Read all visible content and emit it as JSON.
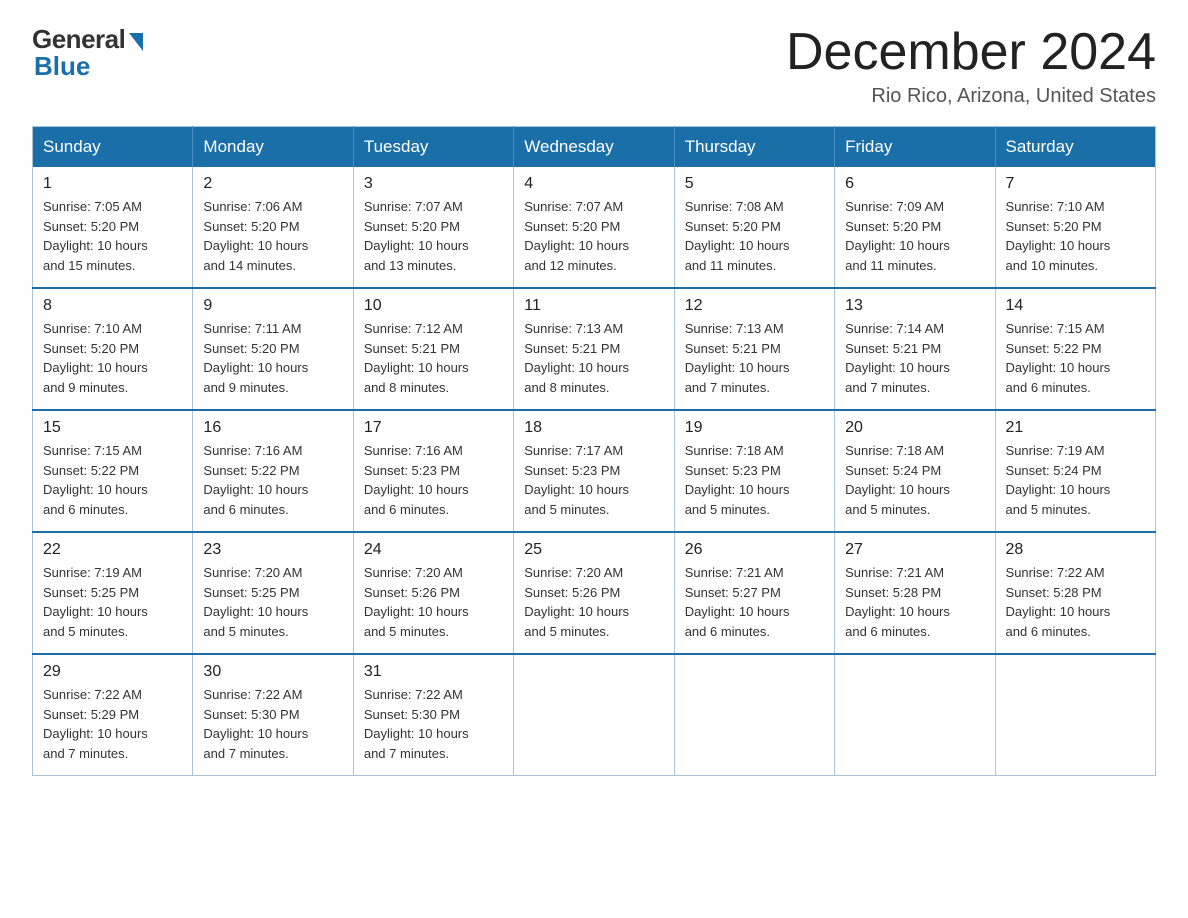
{
  "logo": {
    "general": "General",
    "blue": "Blue"
  },
  "title": {
    "month_year": "December 2024",
    "location": "Rio Rico, Arizona, United States"
  },
  "days_of_week": [
    "Sunday",
    "Monday",
    "Tuesday",
    "Wednesday",
    "Thursday",
    "Friday",
    "Saturday"
  ],
  "weeks": [
    [
      {
        "day": "1",
        "sunrise": "7:05 AM",
        "sunset": "5:20 PM",
        "daylight": "10 hours and 15 minutes."
      },
      {
        "day": "2",
        "sunrise": "7:06 AM",
        "sunset": "5:20 PM",
        "daylight": "10 hours and 14 minutes."
      },
      {
        "day": "3",
        "sunrise": "7:07 AM",
        "sunset": "5:20 PM",
        "daylight": "10 hours and 13 minutes."
      },
      {
        "day": "4",
        "sunrise": "7:07 AM",
        "sunset": "5:20 PM",
        "daylight": "10 hours and 12 minutes."
      },
      {
        "day": "5",
        "sunrise": "7:08 AM",
        "sunset": "5:20 PM",
        "daylight": "10 hours and 11 minutes."
      },
      {
        "day": "6",
        "sunrise": "7:09 AM",
        "sunset": "5:20 PM",
        "daylight": "10 hours and 11 minutes."
      },
      {
        "day": "7",
        "sunrise": "7:10 AM",
        "sunset": "5:20 PM",
        "daylight": "10 hours and 10 minutes."
      }
    ],
    [
      {
        "day": "8",
        "sunrise": "7:10 AM",
        "sunset": "5:20 PM",
        "daylight": "10 hours and 9 minutes."
      },
      {
        "day": "9",
        "sunrise": "7:11 AM",
        "sunset": "5:20 PM",
        "daylight": "10 hours and 9 minutes."
      },
      {
        "day": "10",
        "sunrise": "7:12 AM",
        "sunset": "5:21 PM",
        "daylight": "10 hours and 8 minutes."
      },
      {
        "day": "11",
        "sunrise": "7:13 AM",
        "sunset": "5:21 PM",
        "daylight": "10 hours and 8 minutes."
      },
      {
        "day": "12",
        "sunrise": "7:13 AM",
        "sunset": "5:21 PM",
        "daylight": "10 hours and 7 minutes."
      },
      {
        "day": "13",
        "sunrise": "7:14 AM",
        "sunset": "5:21 PM",
        "daylight": "10 hours and 7 minutes."
      },
      {
        "day": "14",
        "sunrise": "7:15 AM",
        "sunset": "5:22 PM",
        "daylight": "10 hours and 6 minutes."
      }
    ],
    [
      {
        "day": "15",
        "sunrise": "7:15 AM",
        "sunset": "5:22 PM",
        "daylight": "10 hours and 6 minutes."
      },
      {
        "day": "16",
        "sunrise": "7:16 AM",
        "sunset": "5:22 PM",
        "daylight": "10 hours and 6 minutes."
      },
      {
        "day": "17",
        "sunrise": "7:16 AM",
        "sunset": "5:23 PM",
        "daylight": "10 hours and 6 minutes."
      },
      {
        "day": "18",
        "sunrise": "7:17 AM",
        "sunset": "5:23 PM",
        "daylight": "10 hours and 5 minutes."
      },
      {
        "day": "19",
        "sunrise": "7:18 AM",
        "sunset": "5:23 PM",
        "daylight": "10 hours and 5 minutes."
      },
      {
        "day": "20",
        "sunrise": "7:18 AM",
        "sunset": "5:24 PM",
        "daylight": "10 hours and 5 minutes."
      },
      {
        "day": "21",
        "sunrise": "7:19 AM",
        "sunset": "5:24 PM",
        "daylight": "10 hours and 5 minutes."
      }
    ],
    [
      {
        "day": "22",
        "sunrise": "7:19 AM",
        "sunset": "5:25 PM",
        "daylight": "10 hours and 5 minutes."
      },
      {
        "day": "23",
        "sunrise": "7:20 AM",
        "sunset": "5:25 PM",
        "daylight": "10 hours and 5 minutes."
      },
      {
        "day": "24",
        "sunrise": "7:20 AM",
        "sunset": "5:26 PM",
        "daylight": "10 hours and 5 minutes."
      },
      {
        "day": "25",
        "sunrise": "7:20 AM",
        "sunset": "5:26 PM",
        "daylight": "10 hours and 5 minutes."
      },
      {
        "day": "26",
        "sunrise": "7:21 AM",
        "sunset": "5:27 PM",
        "daylight": "10 hours and 6 minutes."
      },
      {
        "day": "27",
        "sunrise": "7:21 AM",
        "sunset": "5:28 PM",
        "daylight": "10 hours and 6 minutes."
      },
      {
        "day": "28",
        "sunrise": "7:22 AM",
        "sunset": "5:28 PM",
        "daylight": "10 hours and 6 minutes."
      }
    ],
    [
      {
        "day": "29",
        "sunrise": "7:22 AM",
        "sunset": "5:29 PM",
        "daylight": "10 hours and 7 minutes."
      },
      {
        "day": "30",
        "sunrise": "7:22 AM",
        "sunset": "5:30 PM",
        "daylight": "10 hours and 7 minutes."
      },
      {
        "day": "31",
        "sunrise": "7:22 AM",
        "sunset": "5:30 PM",
        "daylight": "10 hours and 7 minutes."
      },
      null,
      null,
      null,
      null
    ]
  ],
  "labels": {
    "sunrise": "Sunrise:",
    "sunset": "Sunset:",
    "daylight": "Daylight:"
  }
}
